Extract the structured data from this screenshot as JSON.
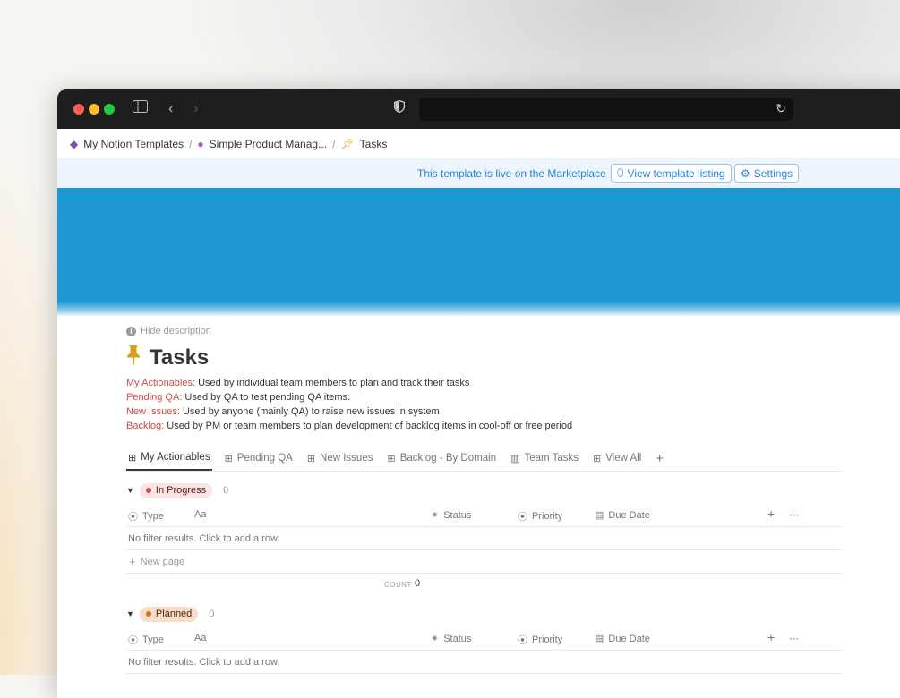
{
  "breadcrumb": [
    {
      "icon": "notion-cube-icon",
      "label": "My Notion Templates"
    },
    {
      "icon": "product-mgmt-icon",
      "label": "Simple Product Manag..."
    },
    {
      "icon": "pushpin-icon",
      "label": "Tasks"
    }
  ],
  "banner": {
    "text": "This template is live on the Marketplace",
    "view_listing": "View template listing",
    "settings": "Settings"
  },
  "page": {
    "hide_description": "Hide description",
    "title": "Tasks",
    "descriptions": [
      {
        "key": "My Actionables:",
        "text": " Used by individual team members to plan and track their tasks"
      },
      {
        "key": "Pending QA:",
        "text": " Used by QA to test pending QA items."
      },
      {
        "key": "New Issues:",
        "text": " Used by anyone (mainly QA) to raise new issues in system"
      },
      {
        "key": "Backlog:",
        "text": " Used by PM or team members to plan development of backlog items in cool-off or free period"
      }
    ]
  },
  "tabs": [
    {
      "label": "My Actionables",
      "icon": "table-icon",
      "active": true
    },
    {
      "label": "Pending QA",
      "icon": "table-icon"
    },
    {
      "label": "New Issues",
      "icon": "table-icon"
    },
    {
      "label": "Backlog - By Domain",
      "icon": "table-icon"
    },
    {
      "label": "Team Tasks",
      "icon": "board-icon"
    },
    {
      "label": "View All",
      "icon": "table-icon"
    }
  ],
  "properties": {
    "type": "Type",
    "name": "Aa",
    "status": "Status",
    "priority": "Priority",
    "due": "Due Date"
  },
  "groups": [
    {
      "name": "In Progress",
      "count": "0",
      "empty": "No filter results. Click to add a row.",
      "new_page": "New page",
      "count_label": "COUNT",
      "count_value": "0"
    },
    {
      "name": "Planned",
      "count": "0",
      "empty": "No filter results. Click to add a row."
    }
  ],
  "colors": {
    "accent": "#2383e2",
    "cover": "#1d98d2",
    "red_label": "#d44c47"
  }
}
